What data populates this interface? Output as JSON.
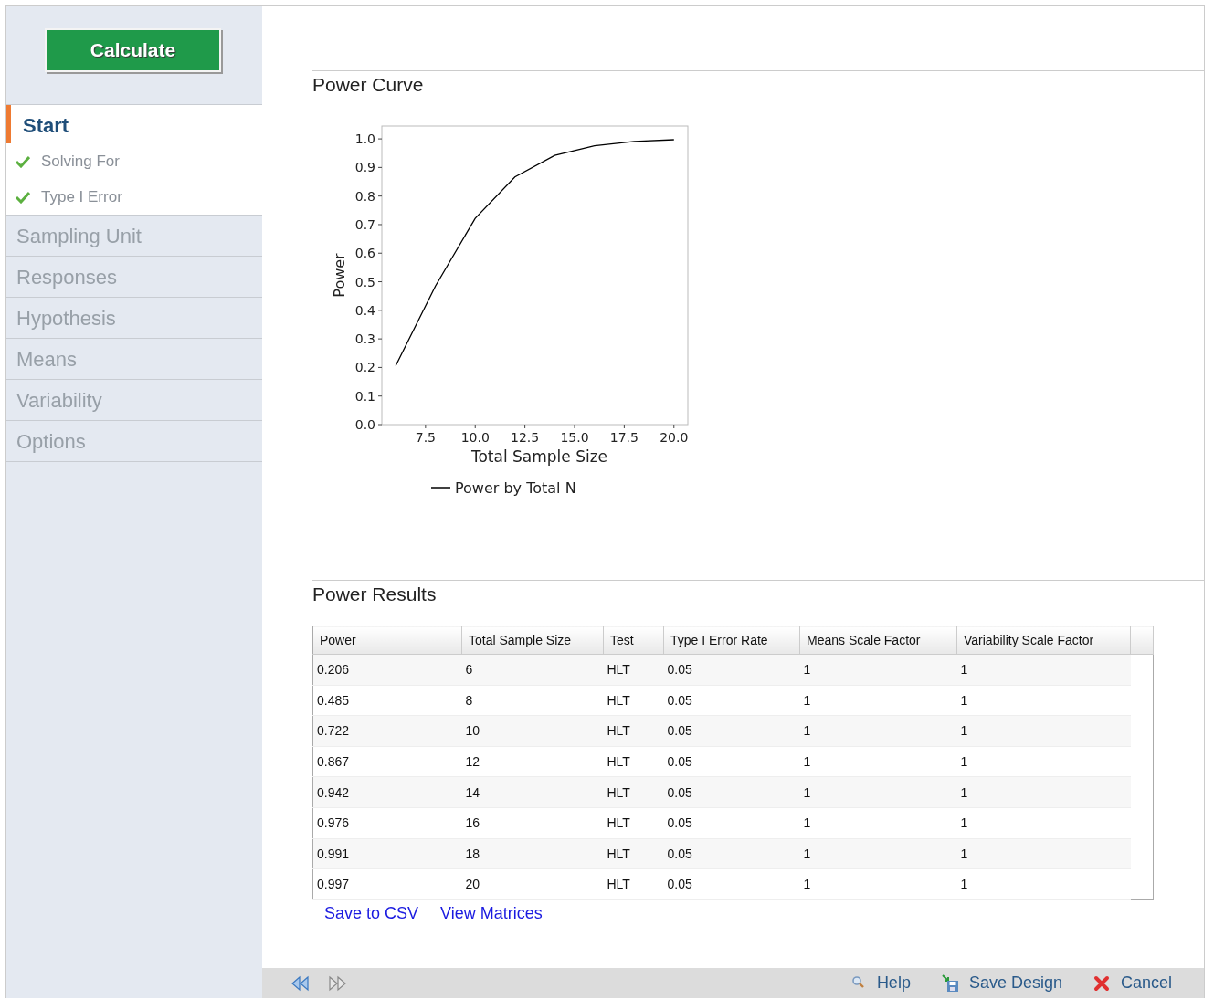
{
  "sidebar": {
    "calculate_button": "Calculate",
    "items": [
      {
        "label": "Start",
        "selected": true,
        "steps": [
          {
            "label": "Solving For",
            "done": true
          },
          {
            "label": "Type I Error",
            "done": true
          }
        ]
      },
      {
        "label": "Sampling Unit",
        "selected": false
      },
      {
        "label": "Responses",
        "selected": false
      },
      {
        "label": "Hypothesis",
        "selected": false
      },
      {
        "label": "Means",
        "selected": false
      },
      {
        "label": "Variability",
        "selected": false
      },
      {
        "label": "Options",
        "selected": false
      }
    ]
  },
  "power_curve": {
    "title": "Power Curve",
    "chart_data": {
      "type": "line",
      "xlabel": "Total Sample Size",
      "ylabel": "Power",
      "x": [
        6,
        8,
        10,
        12,
        14,
        16,
        18,
        20
      ],
      "series": [
        {
          "name": "Power by Total N",
          "color": "#000000",
          "values": [
            0.206,
            0.485,
            0.722,
            0.867,
            0.942,
            0.976,
            0.991,
            0.997
          ]
        }
      ],
      "xlim": [
        5.3,
        20.7
      ],
      "ylim": [
        0,
        1.045
      ],
      "xticks": [
        {
          "value": 7.5,
          "label": "7.5"
        },
        {
          "value": 10,
          "label": "10.0"
        },
        {
          "value": 12.5,
          "label": "12.5"
        },
        {
          "value": 15,
          "label": "15.0"
        },
        {
          "value": 17.5,
          "label": "17.5"
        },
        {
          "value": 20,
          "label": "20.0"
        }
      ],
      "yticks": [
        {
          "value": 0,
          "label": "0.0"
        },
        {
          "value": 0.1,
          "label": "0.1"
        },
        {
          "value": 0.2,
          "label": "0.2"
        },
        {
          "value": 0.3,
          "label": "0.3"
        },
        {
          "value": 0.4,
          "label": "0.4"
        },
        {
          "value": 0.5,
          "label": "0.5"
        },
        {
          "value": 0.6,
          "label": "0.6"
        },
        {
          "value": 0.7,
          "label": "0.7"
        },
        {
          "value": 0.8,
          "label": "0.8"
        },
        {
          "value": 0.9,
          "label": "0.9"
        },
        {
          "value": 1,
          "label": "1.0"
        }
      ]
    }
  },
  "power_results": {
    "title": "Power Results",
    "table": {
      "columns": [
        "Power",
        "Total Sample Size",
        "Test",
        "Type I Error Rate",
        "Means Scale Factor",
        "Variability Scale Factor"
      ],
      "rows": [
        [
          "0.206",
          "6",
          "HLT",
          "0.05",
          "1",
          "1"
        ],
        [
          "0.485",
          "8",
          "HLT",
          "0.05",
          "1",
          "1"
        ],
        [
          "0.722",
          "10",
          "HLT",
          "0.05",
          "1",
          "1"
        ],
        [
          "0.867",
          "12",
          "HLT",
          "0.05",
          "1",
          "1"
        ],
        [
          "0.942",
          "14",
          "HLT",
          "0.05",
          "1",
          "1"
        ],
        [
          "0.976",
          "16",
          "HLT",
          "0.05",
          "1",
          "1"
        ],
        [
          "0.991",
          "18",
          "HLT",
          "0.05",
          "1",
          "1"
        ],
        [
          "0.997",
          "20",
          "HLT",
          "0.05",
          "1",
          "1"
        ]
      ]
    },
    "links": [
      "Save to CSV",
      "View Matrices"
    ]
  },
  "footer": {
    "buttons": [
      {
        "kind": "help",
        "label": "Help"
      },
      {
        "kind": "save",
        "label": "Save Design"
      },
      {
        "kind": "cancel",
        "label": "Cancel"
      }
    ]
  }
}
